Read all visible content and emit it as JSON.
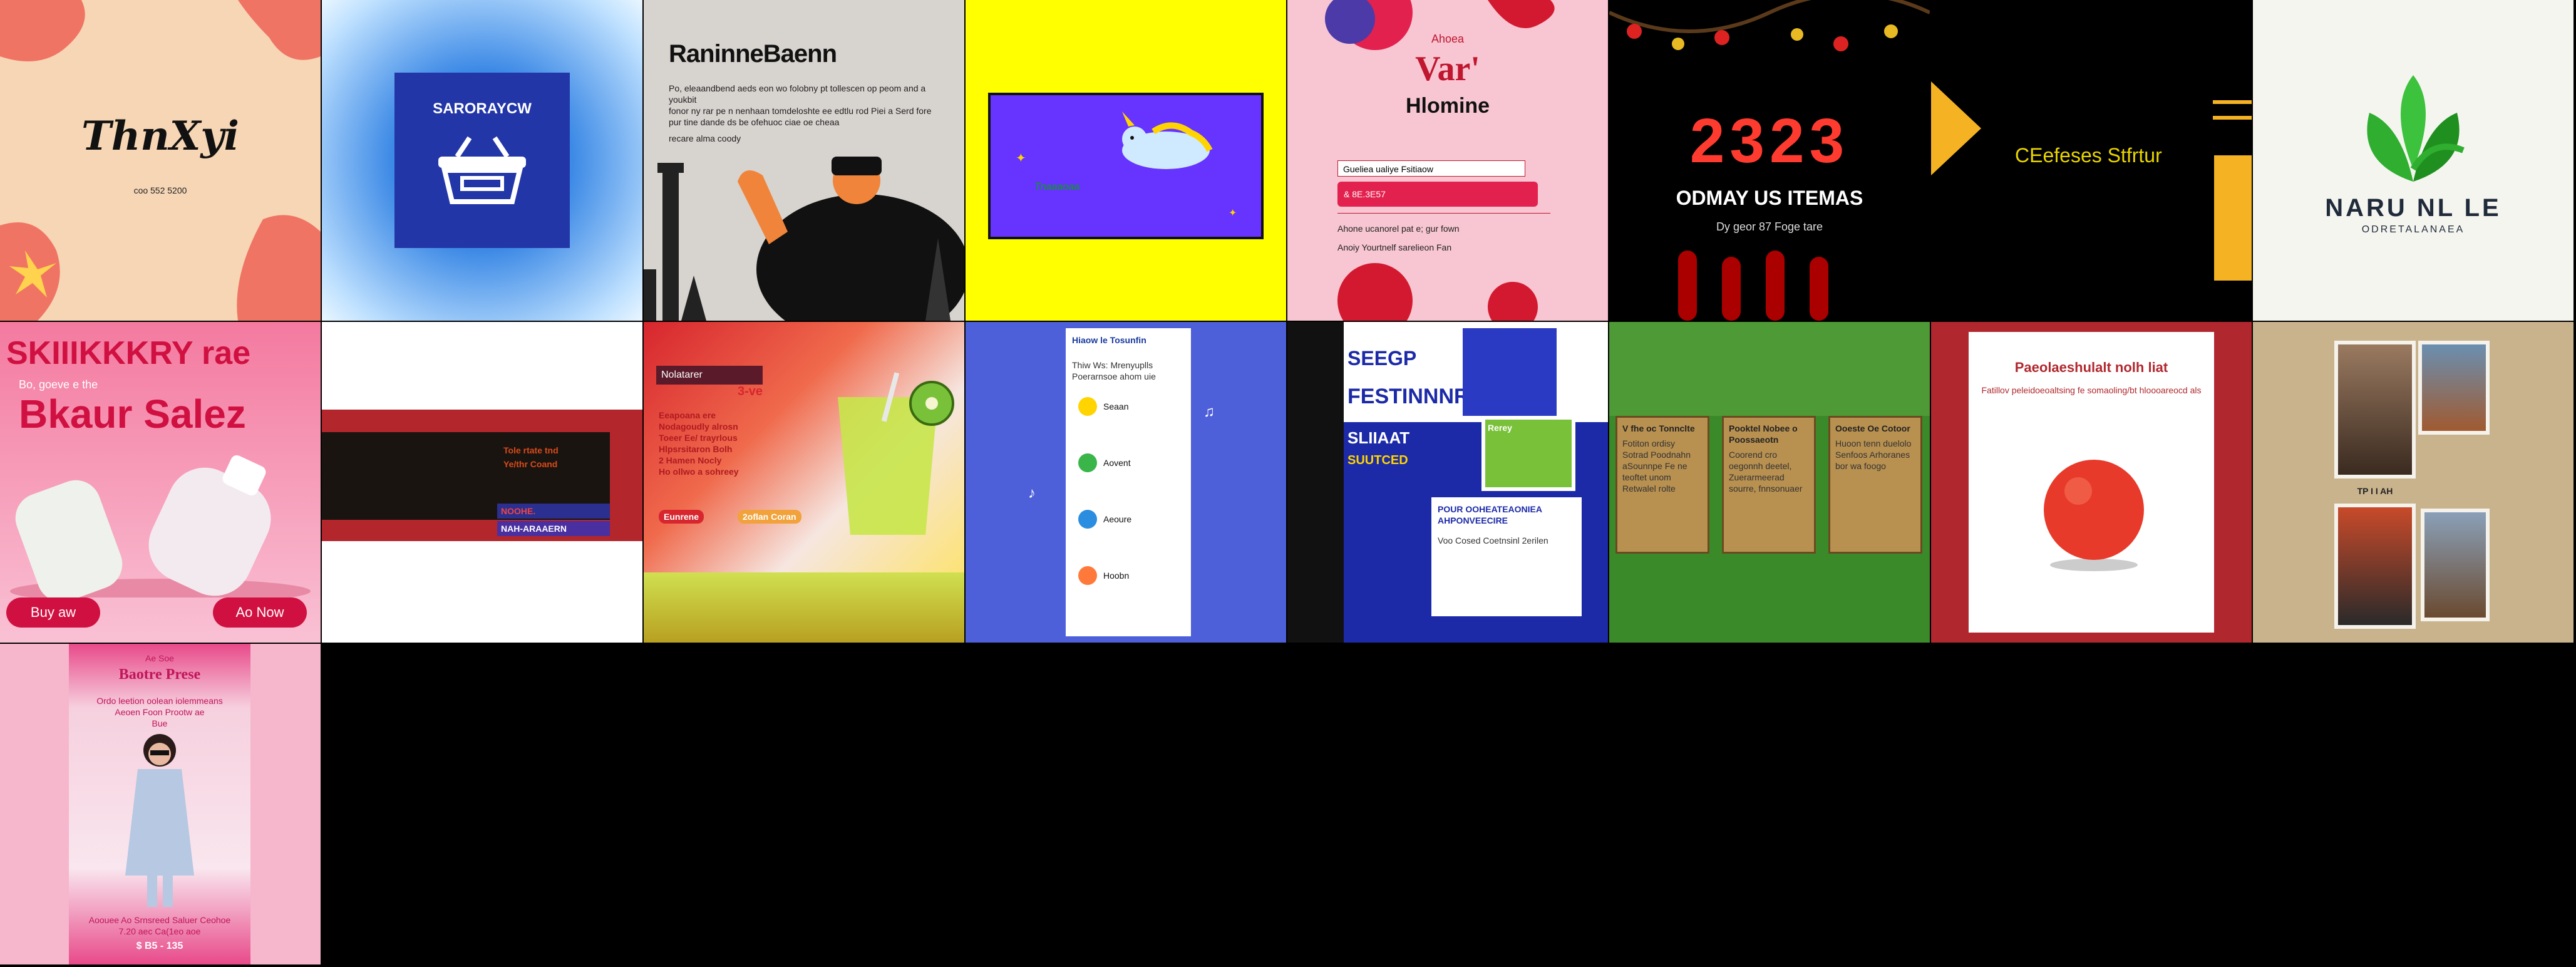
{
  "grid": {
    "columns": 8,
    "rows": 3,
    "background": "#000000"
  },
  "tiles": {
    "t1": {
      "title": "ThnXyi",
      "sub": "coo 552 5200",
      "bg": "#f6d6b5",
      "accent": "#f07463"
    },
    "t2": {
      "title": "SARORAYCW",
      "bg": "#2a6fd3",
      "icon": "basket-icon"
    },
    "t3": {
      "title": "RaninneBaenn",
      "lines": [
        "Po, eleaandbend aeds eon wo folobny pt tollescen op peom and a youkbit",
        "fonor ny rar pe n nenhaan tomdeloshte ee edtlu rod Piei a Serd fore",
        "pur tine dande ds be ofehuoc ciae oe cheaa"
      ],
      "foot": "recare alma coody",
      "icon": "lighthouse-icon"
    },
    "t4": {
      "caption": "Tnaaaoaa",
      "bg": "#ffff00",
      "panel": "#6633ff",
      "icon": "unicorn-icon"
    },
    "t5": {
      "kicker": "Ahoea",
      "headline": "Var'",
      "title": "Hlomine",
      "field1": "Gueliea    ualiye    Fsitiaow",
      "button": "& 8E.3E57",
      "line1": "Ahone ucanorel pat e; gur fown",
      "line2": "Anoiy Yourtnelf sarelieon Fan",
      "bg": "#f7c6d2"
    },
    "t6": {
      "year": "2323",
      "headline": "ODMAY US ITEMAS",
      "sub": "Dy geor 87 Foge tare",
      "bg": "#000000",
      "accent": "#ff3b30"
    },
    "t7": {
      "text": "CEefeses Stfrtur",
      "accent": "#f5b323",
      "text_color": "#e8d400"
    },
    "t8": {
      "title": "NARU NL LE",
      "sub": "ODRETALANAEA",
      "icon": "leaf-icon",
      "bg": "#f5f5f0"
    },
    "t9": {
      "title": "SKIIIKKKRY rae",
      "tag": "Bo, goeve e the",
      "sub": "Bkaur  Salez",
      "btn_left": "Buy aw",
      "btn_right": "Ao  Now",
      "bg": "#f26a8d"
    },
    "t10": {
      "line1": "Tole rtate tnd",
      "line2": "Ye/thr Coand",
      "bar1": "NOOHE.",
      "bar2": "NAH-ARAAERN",
      "bg": "#ffffff"
    },
    "t11": {
      "badge": "Nolatarer",
      "price": "3-ve",
      "lines": [
        "Eeapoana ere",
        "Nodagoudly alrosn",
        "Toeer Ee/ trayrlous",
        "Hlpsrsitaron Bolh",
        "2 Hamen Nocly",
        "Ho ollwo a sohreey"
      ],
      "tags": [
        "Eunrene",
        "2oflan Coran"
      ]
    },
    "t12": {
      "title": "Hiaow  le Tosunfin",
      "sub": "Thiw Ws:  Mrenyuplls Poerarnsoe ahom uie",
      "bg": "#4d5fd9",
      "bullets": [
        "Seaan",
        "Aovent",
        "Aeoure",
        "Hoobn"
      ]
    },
    "t13": {
      "title1": "SEEGP",
      "title2": "FESTINNNR",
      "title3": "SLIIAAT",
      "title4": "SUUTCED",
      "label": "Rerey",
      "box": "POUR OOHEATEAONIEA AHPONVEECIRE",
      "box_line": "Voo Cosed Coetnsinl 2erilen"
    },
    "t14": {
      "cards": [
        {
          "title": "V fhe oc Tonnclte",
          "body": "Fotiton ordisy Sotrad Poodnahn aSounnpe Fe ne teoftet unom Retwalel rolte"
        },
        {
          "title": "Pooktel Nobee o Poossaeotn",
          "body": "Coorend cro oegonnh deetel, Zuerarmeerad sourre, fnnsonuaer"
        },
        {
          "title": "Ooeste Oe Cotoor",
          "body": "Huoon tenn duelolo Senfoos Arhoranes bor wa foogo"
        }
      ],
      "bg": "#3b8a2a"
    },
    "t15": {
      "title": "Paeolaeshulalt nolh liat",
      "sub": "Fatillov peleidoeoaltsing fe somaoling/bt hloooareocd als",
      "bg": "#ffffff",
      "frame": "#b0282e"
    },
    "t16": {
      "label": "TP I I AH",
      "bg": "#c9b38d"
    },
    "t17": {
      "kicker": "Ae  Soe",
      "title": "Baotre Prese",
      "line1": "Ordo leetion oolean iolemmeans",
      "line2": "Aeoen Foon Prootw ae",
      "line3": "Bue",
      "foot1": "Aoouee Ao Srnsreed Saluer Ceohoe",
      "foot2": "7.20 aec Ca(1eo  aoe",
      "price": "$ B5 - 135",
      "bg": "#f6b6cc"
    }
  }
}
